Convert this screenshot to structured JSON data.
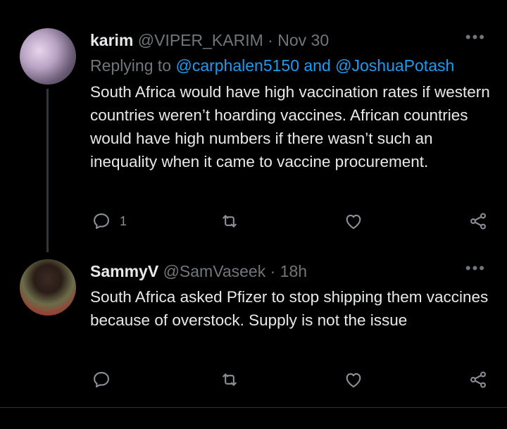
{
  "tweets": [
    {
      "name": "karim",
      "handle": "@VIPER_KARIM",
      "sep": "·",
      "time": "Nov 30",
      "replying_prefix": "Replying to",
      "replying_to": "@carphalen5150 and @JoshuaPotash",
      "text": "South Africa would have high vaccination rates if western countries weren’t hoarding vaccines. African countries would have high numbers if there wasn’t such an inequality when it came to vaccine procurement.",
      "reply_count": "1",
      "more": "•••"
    },
    {
      "name": "SammyV",
      "handle": "@SamVaseek",
      "sep": "·",
      "time": "18h",
      "text": "South Africa asked Pfizer to stop shipping them vaccines because of overstock.   Supply is not the issue",
      "more": "•••"
    }
  ],
  "icons": {
    "reply": "reply-icon",
    "retweet": "retweet-icon",
    "like": "heart-icon",
    "share": "share-icon"
  },
  "colors": {
    "background": "#000000",
    "text": "#e7e9ea",
    "muted": "#71767b",
    "link": "#1d9bf0"
  }
}
